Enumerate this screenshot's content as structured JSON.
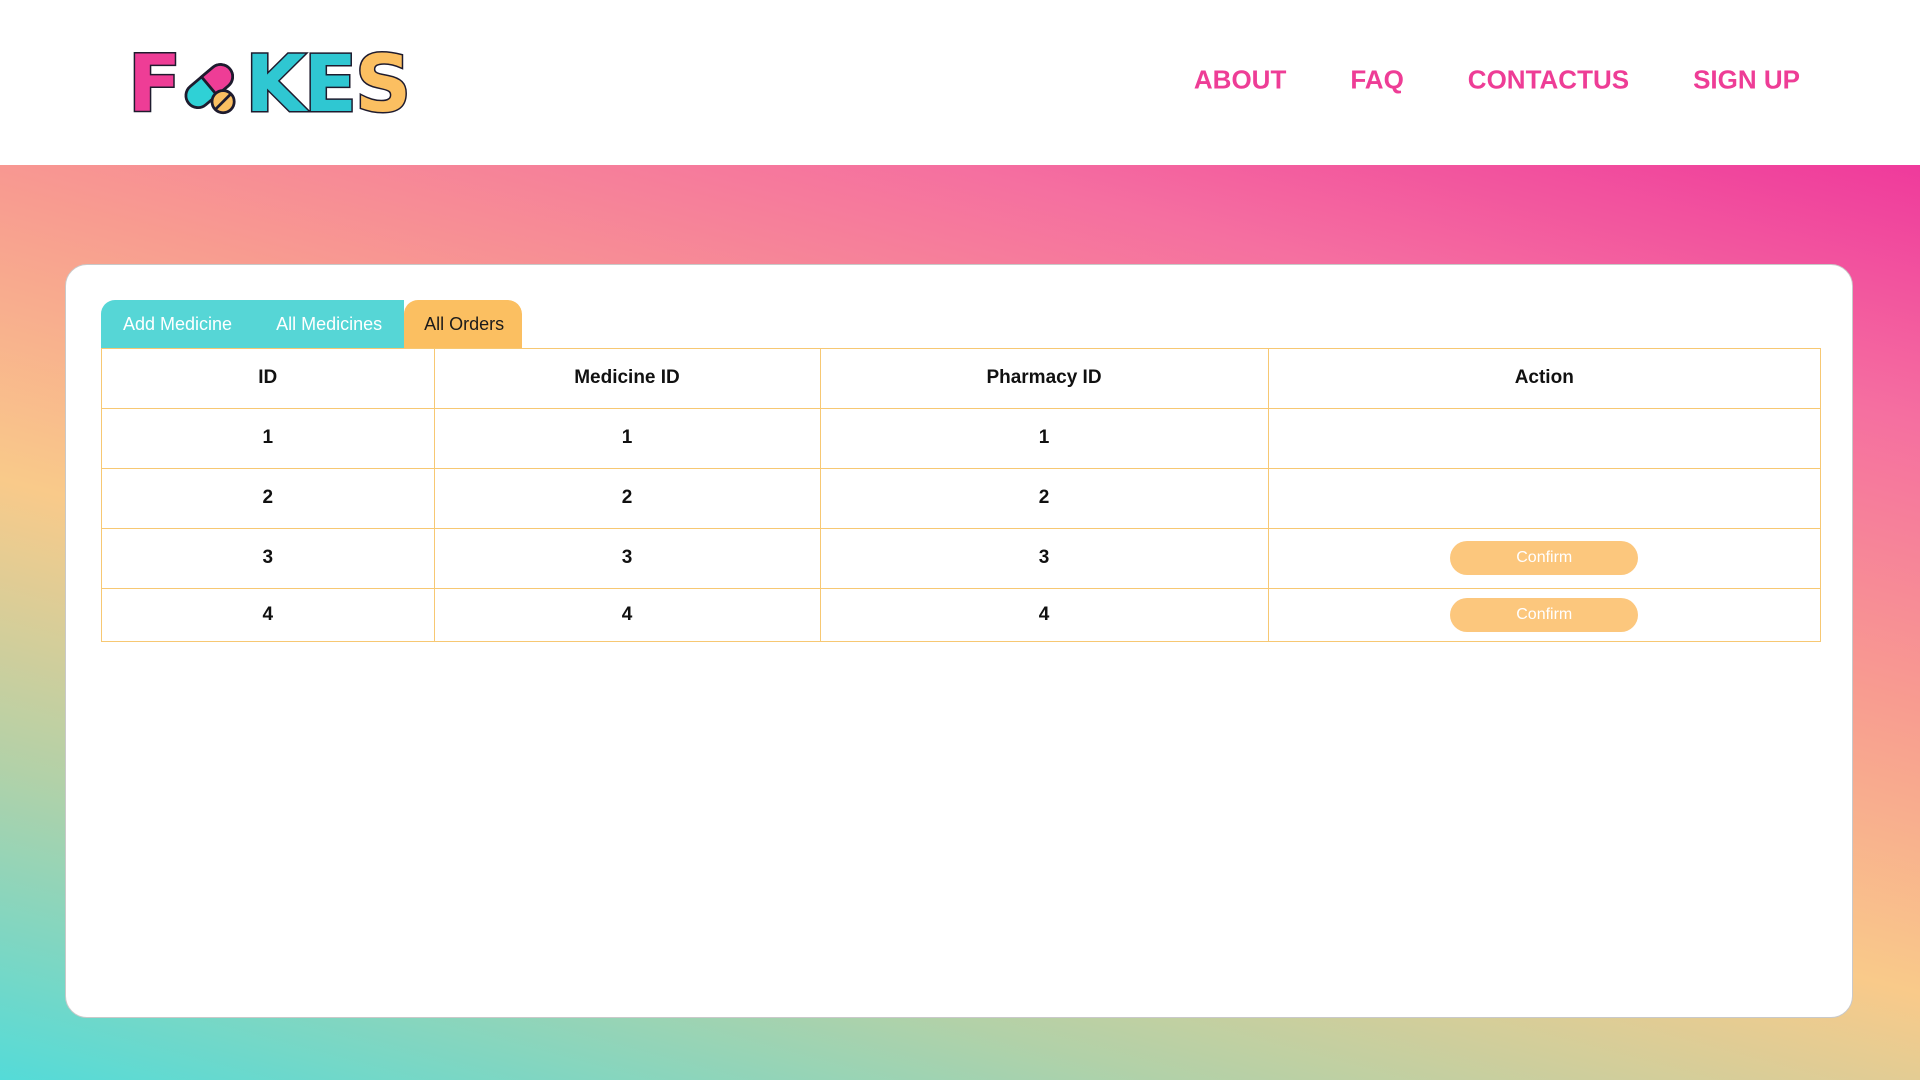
{
  "header": {
    "logo_text": "FAKES",
    "nav": [
      "ABOUT",
      "FAQ",
      "CONTACTUS",
      "SIGN UP"
    ]
  },
  "tabs": [
    {
      "label": "Add Medicine",
      "active": false
    },
    {
      "label": "All Medicines",
      "active": false
    },
    {
      "label": "All Orders",
      "active": true
    }
  ],
  "table": {
    "columns": [
      "ID",
      "Medicine ID",
      "Pharmacy ID",
      "Action"
    ],
    "rows": [
      {
        "id": "1",
        "medicine_id": "1",
        "pharmacy_id": "1",
        "action": ""
      },
      {
        "id": "2",
        "medicine_id": "2",
        "pharmacy_id": "2",
        "action": ""
      },
      {
        "id": "3",
        "medicine_id": "3",
        "pharmacy_id": "3",
        "action": "Confirm"
      },
      {
        "id": "4",
        "medicine_id": "4",
        "pharmacy_id": "4",
        "action": "Confirm"
      }
    ]
  },
  "colors": {
    "accent_pink": "#ee3d96",
    "tab_teal": "#56d6d6",
    "tab_active": "#fbbf61",
    "table_border": "#f7c873",
    "button": "#fcc77d"
  }
}
